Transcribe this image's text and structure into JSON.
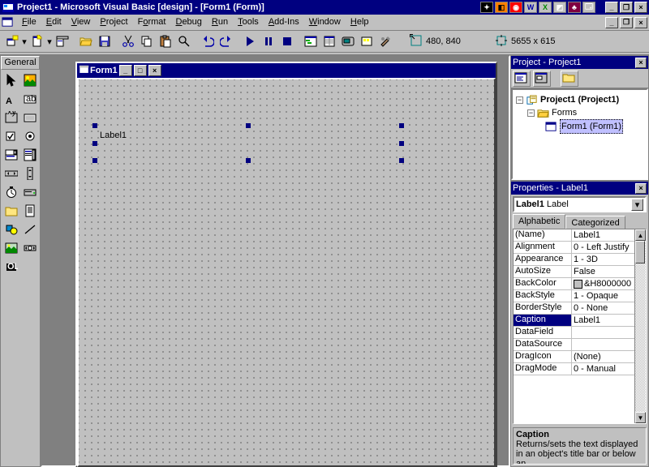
{
  "app_title": "Project1 - Microsoft Visual Basic [design] - [Form1 (Form)]",
  "menu": [
    "File",
    "Edit",
    "View",
    "Project",
    "Format",
    "Debug",
    "Run",
    "Tools",
    "Add-Ins",
    "Window",
    "Help"
  ],
  "toolbar_coords_pos": "480, 840",
  "toolbar_coords_size": "5655 x 615",
  "toolbox_title": "General",
  "form": {
    "title": "Form1",
    "label_caption": "Label1"
  },
  "project_panel": {
    "title": "Project - Project1",
    "root": "Project1 (Project1)",
    "folder": "Forms",
    "item": "Form1 (Form1)"
  },
  "properties_panel": {
    "title": "Properties - Label1",
    "combo_name": "Label1",
    "combo_type": "Label",
    "tabs": [
      "Alphabetic",
      "Categorized"
    ],
    "rows": [
      {
        "n": "(Name)",
        "v": "Label1"
      },
      {
        "n": "Alignment",
        "v": "0 - Left Justify"
      },
      {
        "n": "Appearance",
        "v": "1 - 3D"
      },
      {
        "n": "AutoSize",
        "v": "False"
      },
      {
        "n": "BackColor",
        "v": "&H8000000",
        "swatch": true
      },
      {
        "n": "BackStyle",
        "v": "1 - Opaque"
      },
      {
        "n": "BorderStyle",
        "v": "0 - None"
      },
      {
        "n": "Caption",
        "v": "Label1",
        "sel": true
      },
      {
        "n": "DataField",
        "v": ""
      },
      {
        "n": "DataSource",
        "v": ""
      },
      {
        "n": "DragIcon",
        "v": "(None)"
      },
      {
        "n": "DragMode",
        "v": "0 - Manual"
      }
    ],
    "desc_title": "Caption",
    "desc_body": "Returns/sets the text displayed in an object's title bar or below an"
  }
}
